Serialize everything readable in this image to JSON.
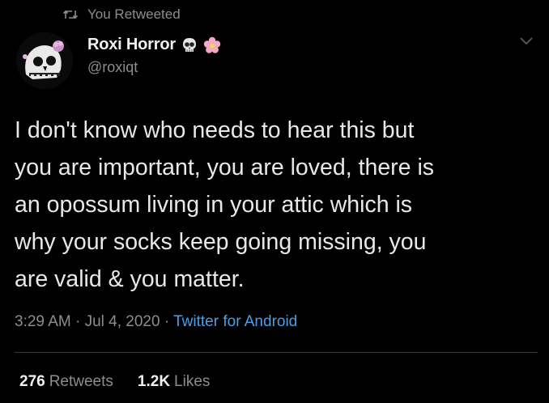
{
  "retweet": {
    "label": "You Retweeted",
    "icon": "retweet-icon"
  },
  "author": {
    "display_name": "Roxi Horror",
    "handle": "@roxiqt",
    "badges": [
      "skull-emoji-icon",
      "cherry-blossom-emoji-icon"
    ],
    "avatar_icon": "skull-avatar"
  },
  "tweet": {
    "lines": [
      "I don't know who needs to hear this but",
      "you are important, you are loved, there is",
      "an opossum living in your attic which is",
      "why your socks keep going missing, you",
      "are valid & you matter."
    ]
  },
  "meta": {
    "time": "3:29 AM",
    "separator": " · ",
    "date": "Jul 4, 2020",
    "source": "Twitter for Android"
  },
  "stats": {
    "retweets_count": "276",
    "retweets_label": "Retweets",
    "likes_count": "1.2K",
    "likes_label": "Likes"
  },
  "colors": {
    "background": "#000000",
    "secondary_text": "#8a8d91",
    "link": "#4a9fe8"
  }
}
